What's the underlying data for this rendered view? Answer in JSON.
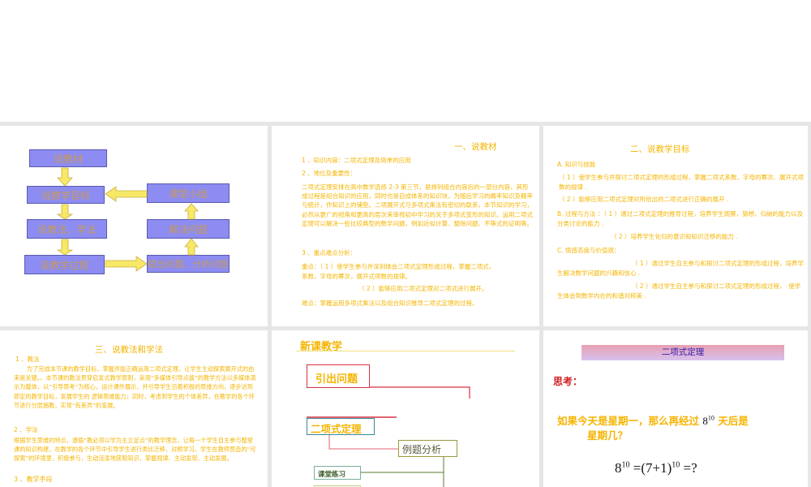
{
  "flowchart": {
    "boxes": [
      "说教材",
      "说教学目标",
      "说教法、学法",
      "说教学过程",
      "课堂小结",
      "解决问题",
      "提出问题、分析问题"
    ]
  },
  "slide2": {
    "title": "一、说教材",
    "items": [
      "1 、知识内容：二项式定理及简单的应用",
      "2 、地位及重要性："
    ],
    "body": "二项式定理安排在高中数学选修 2-3 第三节，是排列组合内容后的一部分内容，其形成过程是组合知识的应用，同时也是自成体系的知识块，为随后学习的概率知识及概率与统计，作知识上的铺垫。二项展开式与多项式乘法有密切的联系，本节知识的学习，必然从更广的视角和更高的层次来审视初中学习的关于多项式变形的知识。运用二项式定理可以解决一些比较典型的数学问题，例如近似计算、整除问题、不等式的证明等。",
    "item3": "3 、重点难点分析：",
    "key1": "重点：（ 1 ）使学生参与并深刻体会二项式定理形成过程，掌握二项式，　　　　　　　　　系数，字母的幂次，展开式项数的规律。",
    "key2": "（ 2 ）能够应用二项式定理对二项式进行展开。",
    "difficult": "难点：掌握运用多项式乘法以及组合知识推导二项式定理的过程。"
  },
  "slide3": {
    "title": "二、说教学目标",
    "a": "A. 知识与技能",
    "a1": "（ 1 ）使学生参与并探讨二项式定理的形成过程，掌握二项式系数、字母的幂次、展开式项数的规律 .",
    "a2": "（ 2 ）能够应用二项式定理对所给出的二项式进行正确的展开 .",
    "b": "B. 过程与方法 ：（ 1 ）通过二项式定理的推导过程，培养学生观察，猜想，归纳的能力以及分类讨论的能力 .",
    "b2": "（ 2 ）培养学生化归的意识和知识迁移的能力 .",
    "c": "C. 情感态度与价值观：",
    "c1": "（ 1 ）通过学生自主参与和探讨二项式定理的形成过程，培养学生解决数学问题的兴趣和信心 .",
    "c2": "（ 2 ）通过学生自主参与和探讨二项式定理的形成过程，　使学生体会到数学内在的和谐对称美 ."
  },
  "slide4": {
    "title": "三、说教法和学法",
    "s1": "1 、教法",
    "p1": "为了完成本节课的教学目标，掌握并能正确运用二项式定理，让学生主动探索展开式的由来是关键。。本节课的教法贯穿启发式教学原则，采用“多媒体引导点拨”的教学方法以多媒体演示为载体，以“引导思考”为核心，设计课件展示，并引导学生沿着积极的思维方向，逐步达到即定的教学目标，发展学生的 逻辑思维能力；同时，考虑到学生的个体差异，在教学的各个环节进行分层施教，实现“有差异”的发展。",
    "s2": "2 、学法",
    "p2": "根据学生思维的特点，遵循“教必须以学为主立足点”的教学理念，让每一个学生自主参与整堂课的知识构建，在教学的各个环节中引导学生进行类比迁移，对照学习。学生在教师营造的“可探索”的环境里，积极参与，生动活泼地获取知识，掌握规律、主动发现、主动发展。",
    "s3": "3 、教学手段"
  },
  "slide5": {
    "title": "新课教学",
    "b1": "引出问题",
    "b2": "二项式定理",
    "b3": "例题分析",
    "b4": "课堂练习"
  },
  "slide6": {
    "title": "二项式定理",
    "think": "思考：",
    "q1": "如果今天是星期一，那么再经过",
    "q_base": "8",
    "q_exp": "10",
    "q2": "天后是",
    "q3": "星期几？",
    "eq_a": "8",
    "eq_a_exp": "10",
    "eq_b": "=(7+1)",
    "eq_b_exp": "10",
    "eq_c": "=?"
  }
}
